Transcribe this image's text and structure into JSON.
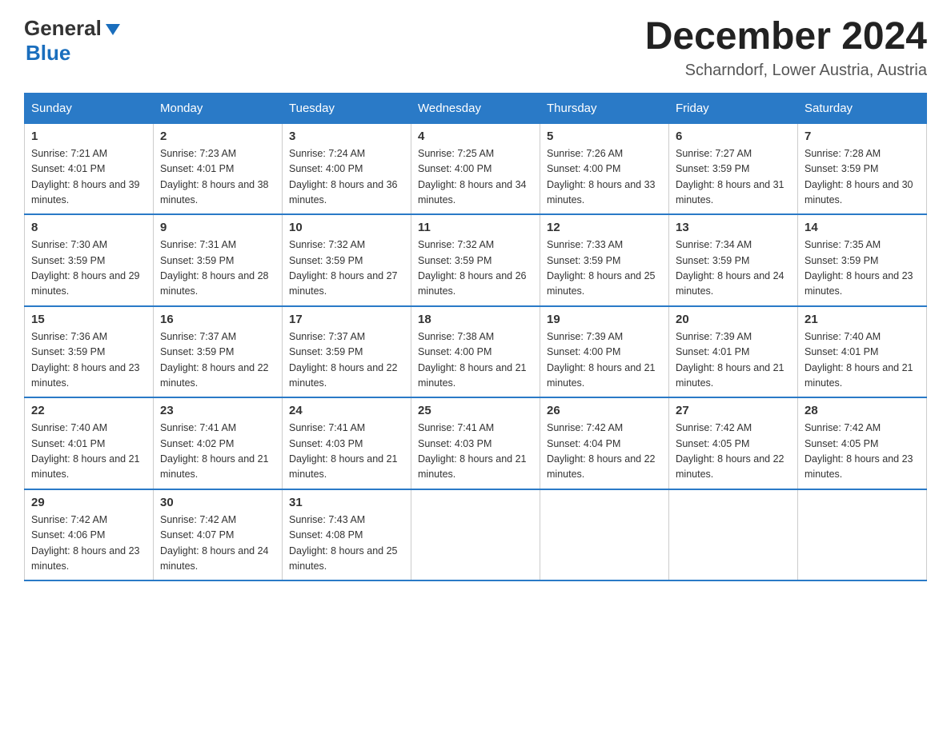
{
  "header": {
    "logo_general": "General",
    "logo_blue": "Blue",
    "month_title": "December 2024",
    "subtitle": "Scharndorf, Lower Austria, Austria"
  },
  "weekdays": [
    "Sunday",
    "Monday",
    "Tuesday",
    "Wednesday",
    "Thursday",
    "Friday",
    "Saturday"
  ],
  "weeks": [
    [
      {
        "day": "1",
        "sunrise": "7:21 AM",
        "sunset": "4:01 PM",
        "daylight": "8 hours and 39 minutes."
      },
      {
        "day": "2",
        "sunrise": "7:23 AM",
        "sunset": "4:01 PM",
        "daylight": "8 hours and 38 minutes."
      },
      {
        "day": "3",
        "sunrise": "7:24 AM",
        "sunset": "4:00 PM",
        "daylight": "8 hours and 36 minutes."
      },
      {
        "day": "4",
        "sunrise": "7:25 AM",
        "sunset": "4:00 PM",
        "daylight": "8 hours and 34 minutes."
      },
      {
        "day": "5",
        "sunrise": "7:26 AM",
        "sunset": "4:00 PM",
        "daylight": "8 hours and 33 minutes."
      },
      {
        "day": "6",
        "sunrise": "7:27 AM",
        "sunset": "3:59 PM",
        "daylight": "8 hours and 31 minutes."
      },
      {
        "day": "7",
        "sunrise": "7:28 AM",
        "sunset": "3:59 PM",
        "daylight": "8 hours and 30 minutes."
      }
    ],
    [
      {
        "day": "8",
        "sunrise": "7:30 AM",
        "sunset": "3:59 PM",
        "daylight": "8 hours and 29 minutes."
      },
      {
        "day": "9",
        "sunrise": "7:31 AM",
        "sunset": "3:59 PM",
        "daylight": "8 hours and 28 minutes."
      },
      {
        "day": "10",
        "sunrise": "7:32 AM",
        "sunset": "3:59 PM",
        "daylight": "8 hours and 27 minutes."
      },
      {
        "day": "11",
        "sunrise": "7:32 AM",
        "sunset": "3:59 PM",
        "daylight": "8 hours and 26 minutes."
      },
      {
        "day": "12",
        "sunrise": "7:33 AM",
        "sunset": "3:59 PM",
        "daylight": "8 hours and 25 minutes."
      },
      {
        "day": "13",
        "sunrise": "7:34 AM",
        "sunset": "3:59 PM",
        "daylight": "8 hours and 24 minutes."
      },
      {
        "day": "14",
        "sunrise": "7:35 AM",
        "sunset": "3:59 PM",
        "daylight": "8 hours and 23 minutes."
      }
    ],
    [
      {
        "day": "15",
        "sunrise": "7:36 AM",
        "sunset": "3:59 PM",
        "daylight": "8 hours and 23 minutes."
      },
      {
        "day": "16",
        "sunrise": "7:37 AM",
        "sunset": "3:59 PM",
        "daylight": "8 hours and 22 minutes."
      },
      {
        "day": "17",
        "sunrise": "7:37 AM",
        "sunset": "3:59 PM",
        "daylight": "8 hours and 22 minutes."
      },
      {
        "day": "18",
        "sunrise": "7:38 AM",
        "sunset": "4:00 PM",
        "daylight": "8 hours and 21 minutes."
      },
      {
        "day": "19",
        "sunrise": "7:39 AM",
        "sunset": "4:00 PM",
        "daylight": "8 hours and 21 minutes."
      },
      {
        "day": "20",
        "sunrise": "7:39 AM",
        "sunset": "4:01 PM",
        "daylight": "8 hours and 21 minutes."
      },
      {
        "day": "21",
        "sunrise": "7:40 AM",
        "sunset": "4:01 PM",
        "daylight": "8 hours and 21 minutes."
      }
    ],
    [
      {
        "day": "22",
        "sunrise": "7:40 AM",
        "sunset": "4:01 PM",
        "daylight": "8 hours and 21 minutes."
      },
      {
        "day": "23",
        "sunrise": "7:41 AM",
        "sunset": "4:02 PM",
        "daylight": "8 hours and 21 minutes."
      },
      {
        "day": "24",
        "sunrise": "7:41 AM",
        "sunset": "4:03 PM",
        "daylight": "8 hours and 21 minutes."
      },
      {
        "day": "25",
        "sunrise": "7:41 AM",
        "sunset": "4:03 PM",
        "daylight": "8 hours and 21 minutes."
      },
      {
        "day": "26",
        "sunrise": "7:42 AM",
        "sunset": "4:04 PM",
        "daylight": "8 hours and 22 minutes."
      },
      {
        "day": "27",
        "sunrise": "7:42 AM",
        "sunset": "4:05 PM",
        "daylight": "8 hours and 22 minutes."
      },
      {
        "day": "28",
        "sunrise": "7:42 AM",
        "sunset": "4:05 PM",
        "daylight": "8 hours and 23 minutes."
      }
    ],
    [
      {
        "day": "29",
        "sunrise": "7:42 AM",
        "sunset": "4:06 PM",
        "daylight": "8 hours and 23 minutes."
      },
      {
        "day": "30",
        "sunrise": "7:42 AM",
        "sunset": "4:07 PM",
        "daylight": "8 hours and 24 minutes."
      },
      {
        "day": "31",
        "sunrise": "7:43 AM",
        "sunset": "4:08 PM",
        "daylight": "8 hours and 25 minutes."
      },
      null,
      null,
      null,
      null
    ]
  ]
}
